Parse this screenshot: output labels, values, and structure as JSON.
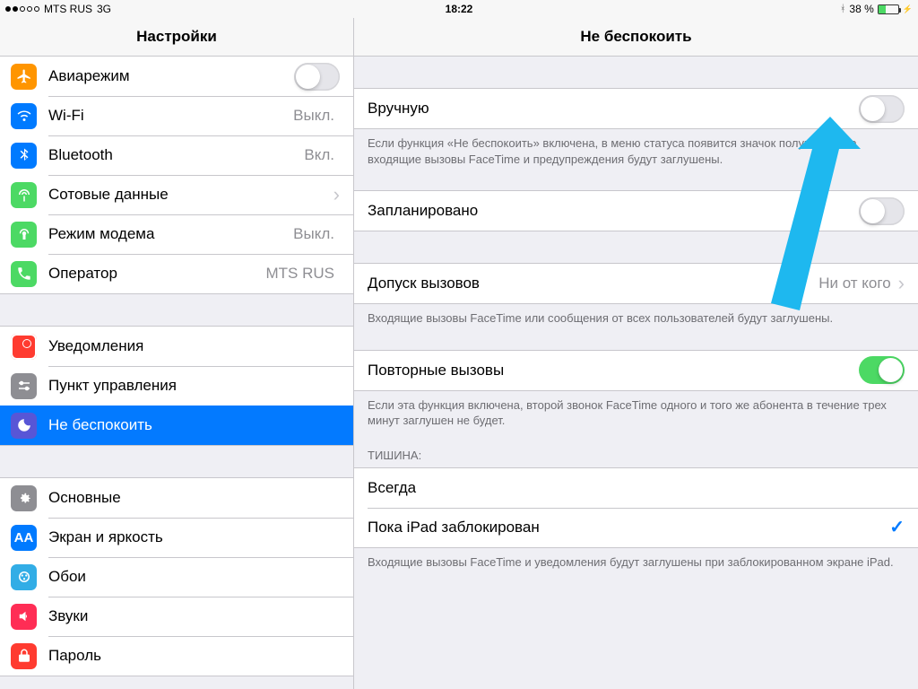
{
  "statusbar": {
    "carrier": "MTS RUS",
    "network": "3G",
    "time": "18:22",
    "battery_text": "38 %"
  },
  "sidebar": {
    "title": "Настройки",
    "groups": [
      {
        "items": [
          {
            "key": "airplane",
            "label": "Авиарежим",
            "value": "",
            "type": "switch"
          },
          {
            "key": "wifi",
            "label": "Wi-Fi",
            "value": "Выкл."
          },
          {
            "key": "bluetooth",
            "label": "Bluetooth",
            "value": "Вкл."
          },
          {
            "key": "cellular",
            "label": "Сотовые данные",
            "value": ""
          },
          {
            "key": "hotspot",
            "label": "Режим модема",
            "value": "Выкл."
          },
          {
            "key": "carrier",
            "label": "Оператор",
            "value": "MTS RUS"
          }
        ]
      },
      {
        "items": [
          {
            "key": "notifications",
            "label": "Уведомления",
            "value": ""
          },
          {
            "key": "controlcenter",
            "label": "Пункт управления",
            "value": ""
          },
          {
            "key": "dnd",
            "label": "Не беспокоить",
            "value": "",
            "selected": true
          }
        ]
      },
      {
        "items": [
          {
            "key": "general",
            "label": "Основные",
            "value": ""
          },
          {
            "key": "display",
            "label": "Экран и яркость",
            "value": ""
          },
          {
            "key": "wallpaper",
            "label": "Обои",
            "value": ""
          },
          {
            "key": "sounds",
            "label": "Звуки",
            "value": ""
          },
          {
            "key": "passcode",
            "label": "Пароль",
            "value": ""
          }
        ]
      }
    ]
  },
  "detail": {
    "title": "Не беспокоить",
    "manual_label": "Вручную",
    "manual_footer": "Если функция «Не беспокоить» включена, в меню статуса появится значок полумесяца, а входящие вызовы FaceTime и предупреждения будут заглушены.",
    "scheduled_label": "Запланировано",
    "allow_calls_label": "Допуск вызовов",
    "allow_calls_value": "Ни от кого",
    "allow_calls_footer": "Входящие вызовы FaceTime или сообщения от всех пользователей будут заглушены.",
    "repeated_label": "Повторные вызовы",
    "repeated_footer": "Если эта функция включена, второй звонок FaceTime одного и того же абонента в течение трех минут заглушен не будет.",
    "silence_header": "ТИШИНА:",
    "silence_always": "Всегда",
    "silence_locked": "Пока iPad заблокирован",
    "silence_footer": "Входящие вызовы FaceTime и уведомления будут заглушены при заблокированном экране iPad."
  }
}
